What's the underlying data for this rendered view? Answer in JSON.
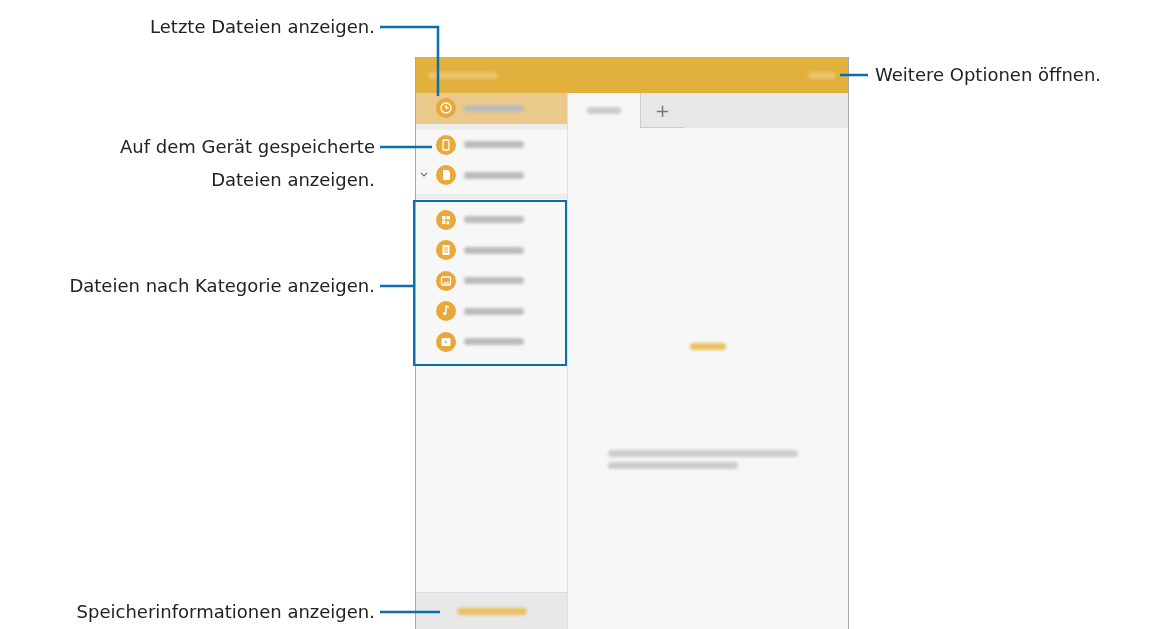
{
  "callouts": [
    {
      "text": "Letzte Dateien anzeigen."
    },
    {
      "text": "Auf dem Gerät gespeicherte Dateien anzeigen."
    },
    {
      "text": "Dateien nach Kategorie anzeigen."
    },
    {
      "text": "Speicherinformationen anzeigen."
    },
    {
      "text": "Weitere Optionen öffnen."
    }
  ],
  "sidebar": {
    "items": [
      {
        "selected": true,
        "expanded": false
      },
      {
        "selected": false,
        "expanded": false
      },
      {
        "selected": false,
        "expanded": true
      }
    ],
    "categories": [
      {
        "selected": false
      },
      {
        "selected": false
      },
      {
        "selected": false
      },
      {
        "selected": false
      },
      {
        "selected": false
      }
    ]
  },
  "tabs": [
    {
      "selected": true
    },
    {
      "label": "+",
      "selected": false
    }
  ]
}
